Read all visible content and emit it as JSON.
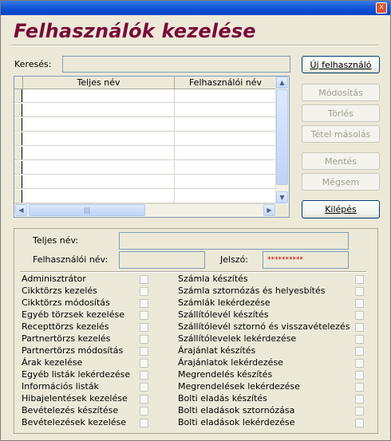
{
  "window": {
    "title": "Felhasználók kezelése",
    "close_glyph": "x"
  },
  "search": {
    "label": "Keresés:",
    "value": ""
  },
  "grid": {
    "columns": [
      "Teljes név",
      "Felhasználói név"
    ],
    "row_count": 8,
    "rows": []
  },
  "buttons": {
    "new_user": "Új felhasználó",
    "modify": "Módosítás",
    "delete": "Törlés",
    "copy_item": "Tétel másolás",
    "save": "Mentés",
    "cancel": "Mégsem",
    "exit": "Kilépés"
  },
  "form": {
    "full_name_label": "Teljes név:",
    "full_name_value": "",
    "username_label": "Felhasználói név:",
    "username_value": "",
    "password_label": "Jelszó:",
    "password_value": "**********"
  },
  "permissions_left": [
    "Adminisztrátor",
    "Cikktörzs kezelés",
    "Cikktörzs módosítás",
    "Egyéb törzsek kezelése",
    "Recepttörzs kezelés",
    "Partnertörzs kezelés",
    "Partnertörzs módosítás",
    "Árak kezelése",
    "Egyéb listák lekérdezése",
    "Információs listák",
    "Hibajelentések kezelése",
    "Bevételezés készítése",
    "Bevételezések kezelése"
  ],
  "permissions_right": [
    "Számla készítés",
    "Számla sztornózás és helyesbítés",
    "Számlák lekérdezése",
    "Szállítólevél készítés",
    "Szállítólevél sztornó és visszavételezés",
    "Szállítólevelek lekérdezése",
    "Árajánlat készítés",
    "Árajánlatok lekérdezése",
    "Megrendelés készítés",
    "Megrendelések lekérdezése",
    "Bolti eladás készítés",
    "Bolti eladások sztornózása",
    "Bolti eladások lekérdezése"
  ],
  "icons": {
    "scroll_up": "▲",
    "scroll_down": "▼",
    "scroll_left": "◀",
    "scroll_right": "▶",
    "thumb_grip": "|||"
  }
}
